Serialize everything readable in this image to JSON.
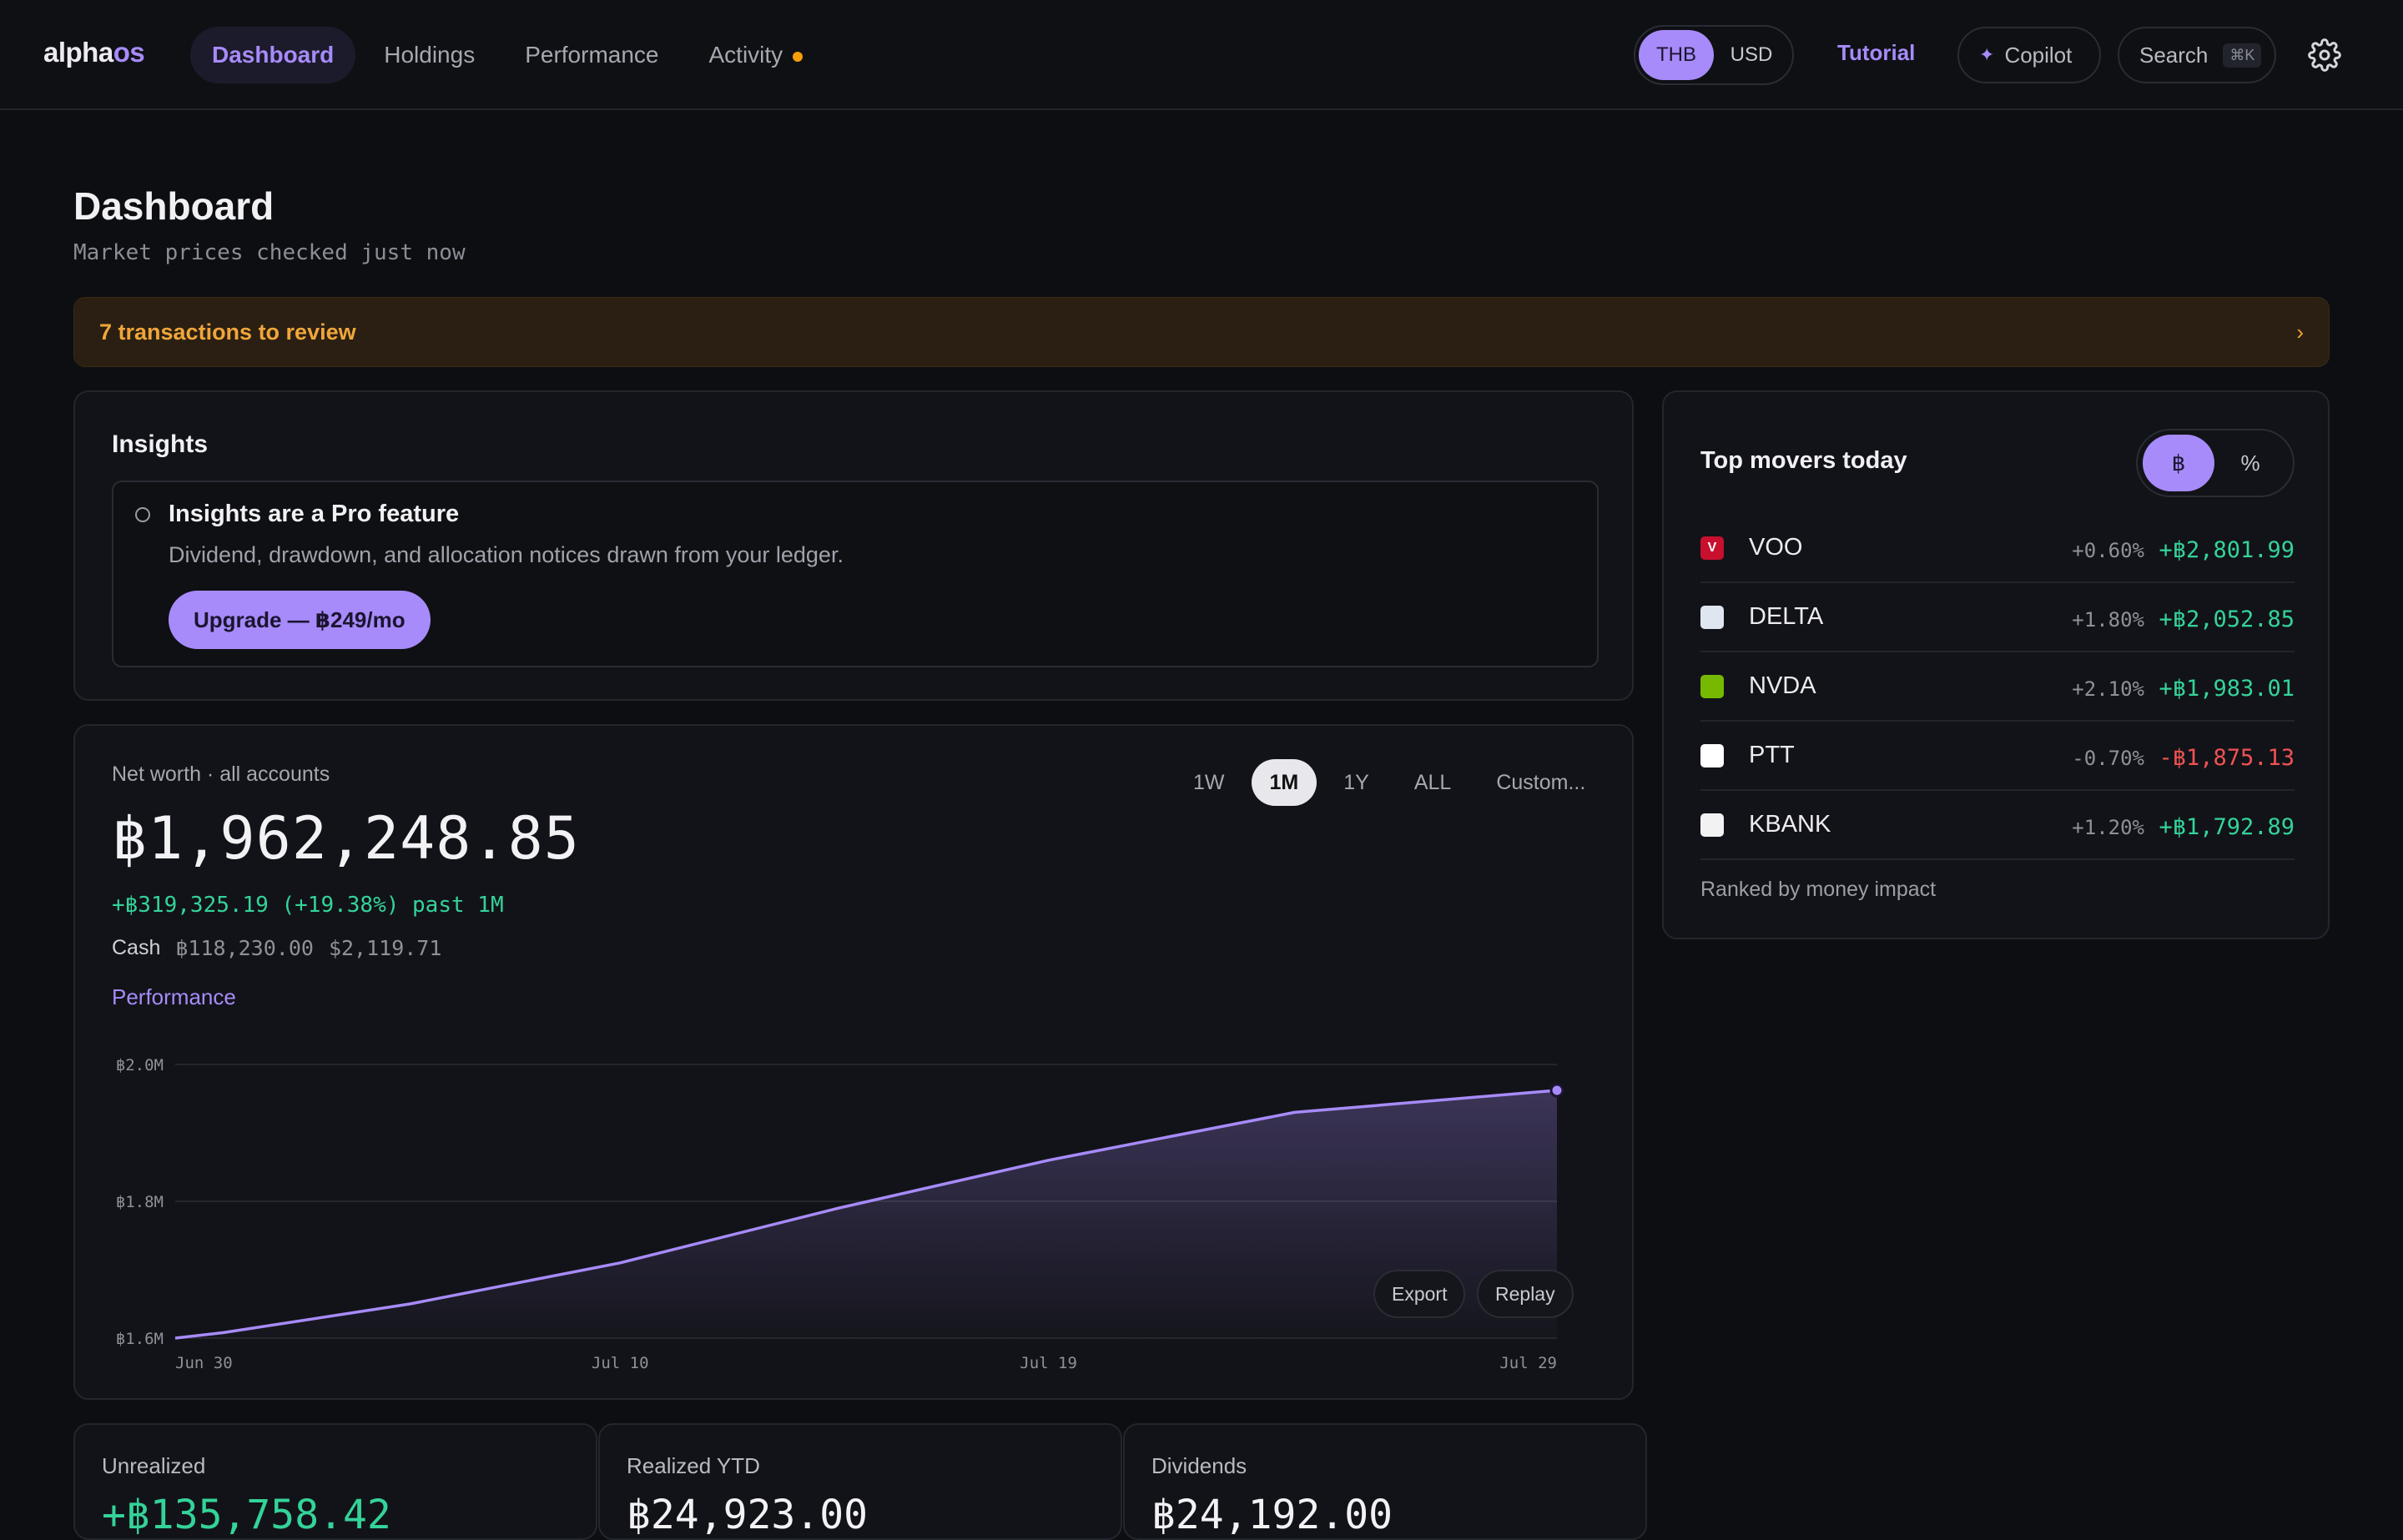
{
  "brand": {
    "part1": "alpha",
    "part2": "os"
  },
  "nav": [
    {
      "label": "Dashboard",
      "active": true
    },
    {
      "label": "Holdings"
    },
    {
      "label": "Performance"
    },
    {
      "label": "Activity",
      "badge": true
    }
  ],
  "currency": {
    "options": [
      "THB",
      "USD"
    ],
    "selected": "THB"
  },
  "header_actions": {
    "tutorial": "Tutorial",
    "copilot": "Copilot",
    "search": "Search",
    "search_shortcut": "⌘K"
  },
  "page": {
    "title": "Dashboard",
    "subtitle": "Market prices checked just now"
  },
  "alert": {
    "text": "7 transactions to review",
    "chevron": "›"
  },
  "insights": {
    "title": "Insights",
    "pro_title": "Insights are a Pro feature",
    "pro_desc": "Dividend, drawdown, and allocation notices drawn from your ledger.",
    "upgrade_label": "Upgrade — ฿249/mo"
  },
  "networth": {
    "label": "Net worth · all accounts",
    "value": "฿1,962,248.85",
    "change": "+฿319,325.19 (+19.38%) past 1M",
    "cash_label": "Cash",
    "cash_thb": "฿118,230.00",
    "cash_usd": "$2,119.71",
    "performance_link": "Performance",
    "ranges": [
      "1W",
      "1M",
      "1Y",
      "ALL",
      "Custom..."
    ],
    "selected_range": "1M",
    "export_label": "Export",
    "replay_label": "Replay"
  },
  "chart_data": {
    "type": "area",
    "x": [
      "Jun 30",
      "Jul 1",
      "Jul 5",
      "Jul 10",
      "Jul 15",
      "Jul 19",
      "Jul 24",
      "Jul 29"
    ],
    "values": [
      1600000,
      1608000,
      1650000,
      1710000,
      1790000,
      1860000,
      1930000,
      1962248.85
    ],
    "x_tick_labels": [
      "Jun 30",
      "Jul 10",
      "Jul 19",
      "Jul 29"
    ],
    "y_tick_labels": [
      "฿2.0M",
      "฿1.8M",
      "฿1.6M"
    ],
    "y_ticks": [
      2000000,
      1800000,
      1600000
    ],
    "ylim": [
      1600000,
      2000000
    ],
    "grid": true,
    "color": "#a78bfa"
  },
  "movers": {
    "title": "Top movers today",
    "toggle": [
      "฿",
      "%"
    ],
    "toggle_selected": "฿",
    "footer": "Ranked by money impact",
    "items": [
      {
        "ticker": "VOO",
        "pct": "+0.60%",
        "amount": "+฿2,801.99",
        "direction": "up",
        "icon_color": "#c8102e",
        "icon_glyph": "V"
      },
      {
        "ticker": "DELTA",
        "pct": "+1.80%",
        "amount": "+฿2,052.85",
        "direction": "up",
        "icon_color": "#dfe6f0",
        "icon_glyph": ""
      },
      {
        "ticker": "NVDA",
        "pct": "+2.10%",
        "amount": "+฿1,983.01",
        "direction": "up",
        "icon_color": "#76b900",
        "icon_glyph": ""
      },
      {
        "ticker": "PTT",
        "pct": "-0.70%",
        "amount": "-฿1,875.13",
        "direction": "down",
        "icon_color": "#ffffff",
        "icon_glyph": ""
      },
      {
        "ticker": "KBANK",
        "pct": "+1.20%",
        "amount": "+฿1,792.89",
        "direction": "up",
        "icon_color": "#f2f2f2",
        "icon_glyph": ""
      }
    ]
  },
  "stats": [
    {
      "label": "Unrealized",
      "value": "+฿135,758.42",
      "positive": true
    },
    {
      "label": "Realized YTD",
      "value": "฿24,923.00"
    },
    {
      "label": "Dividends",
      "value": "฿24,192.00"
    }
  ],
  "colors": {
    "accent": "#a78bfa",
    "positive": "#34d399",
    "negative": "#f05252",
    "warning": "#f0a63a"
  }
}
